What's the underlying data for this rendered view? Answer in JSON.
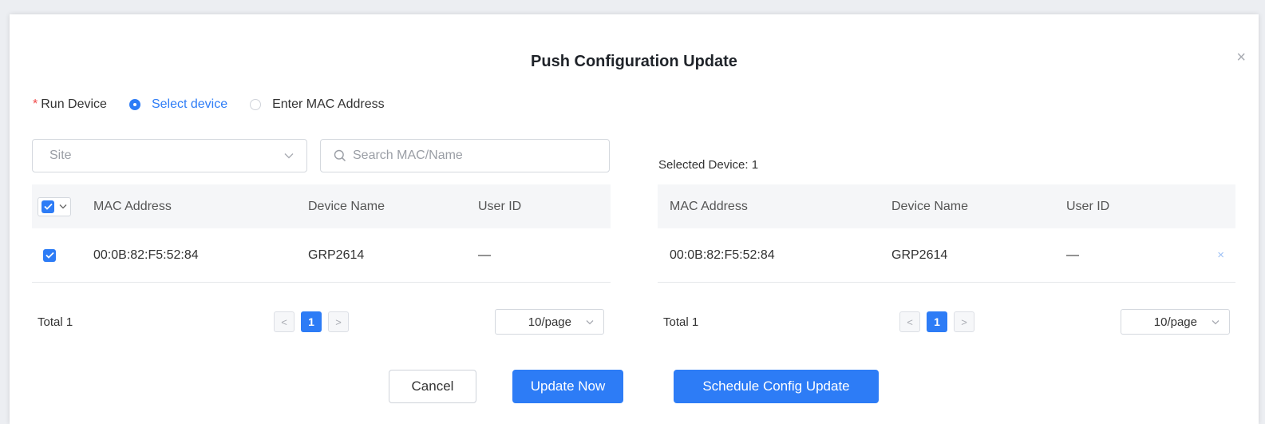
{
  "dialog": {
    "title": "Push Configuration Update",
    "close_icon": "×"
  },
  "run_device": {
    "required_mark": "*",
    "label": "Run Device",
    "options": [
      "Select device",
      "Enter MAC Address"
    ],
    "selected": "Select device"
  },
  "filters": {
    "site_placeholder": "Site",
    "search_placeholder": "Search MAC/Name"
  },
  "left_table": {
    "columns": [
      "MAC Address",
      "Device Name",
      "User ID"
    ],
    "rows": [
      {
        "mac": "00:0B:82:F5:52:84",
        "name": "GRP2614",
        "user_id": "—",
        "checked": true
      }
    ],
    "total": "Total 1",
    "page": "1",
    "page_size": "10/page"
  },
  "right_table": {
    "selected_label": "Selected Device: 1",
    "columns": [
      "MAC Address",
      "Device Name",
      "User ID"
    ],
    "rows": [
      {
        "mac": "00:0B:82:F5:52:84",
        "name": "GRP2614",
        "user_id": "—",
        "remove": "×"
      }
    ],
    "total": "Total 1",
    "page": "1",
    "page_size": "10/page"
  },
  "footer": {
    "cancel": "Cancel",
    "update_now": "Update Now",
    "schedule": "Schedule Config Update"
  },
  "colors": {
    "primary": "#2d7cf6",
    "required": "#f04848"
  }
}
